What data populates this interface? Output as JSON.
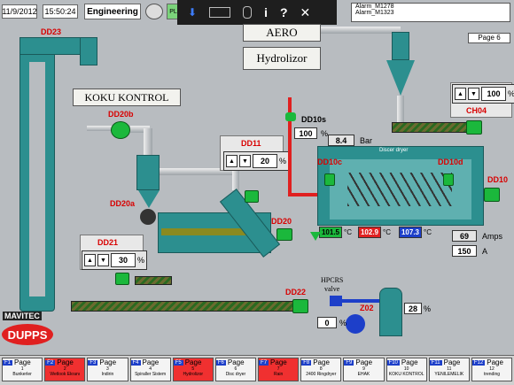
{
  "header": {
    "date": "11/9/2012",
    "time": "15:50:24",
    "mode": "Engineering",
    "plc_label": "PLC",
    "alarms": [
      {
        "code": "Alarm_M1278"
      },
      {
        "code": "Alarm_M1323"
      }
    ],
    "page_label": "Page 6"
  },
  "toolbar": {
    "info": "i",
    "help": "?",
    "close": "✕"
  },
  "sections": {
    "aero": "AERO",
    "hydrolizor": "Hydrolizor",
    "koku": "KOKU KONTROL"
  },
  "tags": {
    "dd23": "DD23",
    "dd20b": "DD20b",
    "dd20a": "DD20a",
    "dd21": "DD21",
    "dd11": "DD11",
    "dd10s": "DD10s",
    "dd10c": "DD10c",
    "dd10d": "DD10d",
    "dd10": "DD10",
    "dd20": "DD20",
    "ch04": "CH04",
    "dd22": "DD22",
    "z02": "Z02",
    "hpcrs": "HPCRS",
    "valve": "valve",
    "bar": "Bar",
    "dryer": "Discer dryer",
    "amps": "Amps",
    "amps_unit_a": "A"
  },
  "values": {
    "dd10s_pct": "100",
    "pressure": "8.4",
    "ch04_sp": "100",
    "dd11_sp": "20",
    "dd21_sp": "30",
    "temp1": "101.5",
    "temp2": "102.9",
    "temp3": "107.3",
    "amps": "69",
    "amps_sp": "150",
    "valve_pct": "0",
    "z02_pct": "28",
    "pct_unit": "%",
    "deg_unit": "°C"
  },
  "logos": {
    "mavitec": "MAVITEC",
    "dupps": "DUPPS"
  },
  "fkeys": [
    {
      "f": "F1",
      "page": "Page",
      "num": "1",
      "name": "Bunkerler",
      "active": false
    },
    {
      "f": "F2",
      "page": "Page",
      "num": "2",
      "name": "Wetlook Ekranı",
      "active": true
    },
    {
      "f": "F3",
      "page": "Page",
      "num": "3",
      "name": "Indirin",
      "active": false
    },
    {
      "f": "F4",
      "page": "Page",
      "num": "4",
      "name": "Spiraller Sistem",
      "active": false
    },
    {
      "f": "F5",
      "page": "Page",
      "num": "5",
      "name": "Hydrolizor",
      "active": true
    },
    {
      "f": "F6",
      "page": "Page",
      "num": "6",
      "name": "Disc dryer",
      "active": false
    },
    {
      "f": "F7",
      "page": "Page",
      "num": "7",
      "name": "Rain",
      "active": true
    },
    {
      "f": "F8",
      "page": "Page",
      "num": "8",
      "name": "2400 Ringdryer",
      "active": false
    },
    {
      "f": "F9",
      "page": "Page",
      "num": "9",
      "name": "EHAK",
      "active": false
    },
    {
      "f": "F10",
      "page": "Page",
      "num": "10",
      "name": "KOKU KONTROL",
      "active": false
    },
    {
      "f": "F11",
      "page": "Page",
      "num": "11",
      "name": "YENILEMELIK",
      "active": false
    },
    {
      "f": "F12",
      "page": "Page",
      "num": "12",
      "name": "trending",
      "active": false
    }
  ]
}
